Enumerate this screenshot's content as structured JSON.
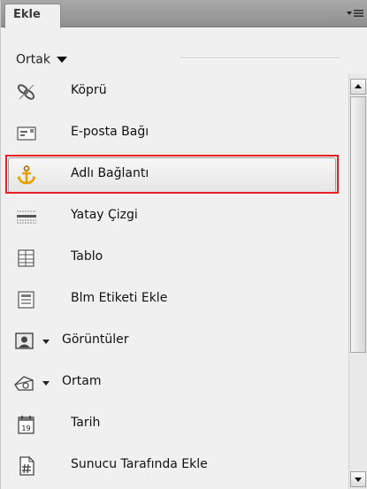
{
  "panel": {
    "tab_label": "Ekle",
    "menu_icon": "panel-menu-icon"
  },
  "category": {
    "selected": "Ortak"
  },
  "items": [
    {
      "label": "Köprü",
      "icon": "hyperlink-icon"
    },
    {
      "label": "E-posta Bağı",
      "icon": "email-link-icon"
    },
    {
      "label": "Adlı Bağlantı",
      "icon": "named-anchor-icon",
      "selected": true
    },
    {
      "label": "Yatay Çizgi",
      "icon": "horizontal-rule-icon"
    },
    {
      "label": "Tablo",
      "icon": "table-icon"
    },
    {
      "label": "Blm Etiketi Ekle",
      "icon": "insert-div-tag-icon"
    },
    {
      "label": "Görüntüler",
      "icon": "images-icon",
      "has_dropdown": true
    },
    {
      "label": "Ortam",
      "icon": "media-icon",
      "has_dropdown": true
    },
    {
      "label": "Tarih",
      "icon": "date-icon"
    },
    {
      "label": "Sunucu Tarafında Ekle",
      "icon": "server-side-include-icon"
    }
  ],
  "colors": {
    "highlight_outline": "#e81f25",
    "anchor_icon": "#e8a000"
  }
}
